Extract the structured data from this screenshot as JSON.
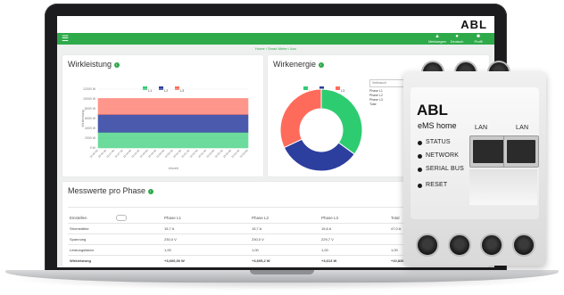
{
  "app": {
    "logo": "ABL",
    "breadcrumb": "Home / Smart Meter / Aux",
    "nav": [
      {
        "label": "Meldungen",
        "icon": "bell-icon"
      },
      {
        "label": "Deutsch",
        "icon": "language-icon"
      },
      {
        "label": "Profil",
        "icon": "user-icon"
      }
    ]
  },
  "wirkleistung": {
    "title": "Wirkleistung",
    "legend": [
      "L1",
      "L2",
      "L3"
    ],
    "y_ticks": [
      "12000 W",
      "10000 W",
      "8000 W",
      "6000 W",
      "4000 W",
      "2000 W",
      "0 W"
    ],
    "ylabel": "Wirkleistung",
    "xlabel": "Uhrzeit",
    "x_ticks": [
      "10:46:00",
      "10:46:30",
      "10:47:00",
      "10:47:30",
      "10:48:00",
      "10:48:30",
      "10:49:00",
      "10:49:30",
      "10:50:00",
      "10:50:30",
      "10:51:00",
      "10:51:30",
      "10:52:00",
      "10:52:30",
      "10:53:00",
      "10:53:30",
      "10:54:00",
      "10:54:30",
      "10:55:00"
    ]
  },
  "wirkenergie": {
    "title": "Wirkenergie",
    "legend": [
      "L1",
      "L2",
      "L3"
    ],
    "select_label": "Verbrauch",
    "list": [
      "Phase L1",
      "Phase L2",
      "Phase L3",
      "Total"
    ]
  },
  "colors": {
    "green": "#2eaa4a",
    "l1": "#2ecc71",
    "l2": "#2c3e9e",
    "l3": "#ff6b5b"
  },
  "chart_data": [
    {
      "type": "area",
      "title": "Wirkleistung",
      "xlabel": "Uhrzeit",
      "ylabel": "Wirkleistung",
      "ylim": [
        0,
        12000
      ],
      "series": [
        {
          "name": "L1",
          "values": [
            3200,
            3200,
            3200,
            3200,
            3200,
            3200,
            3200,
            3200,
            3200,
            3200,
            3200,
            3200,
            3200,
            3200,
            3200,
            3200,
            3200,
            3200,
            3200
          ]
        },
        {
          "name": "L2",
          "values": [
            3600,
            3600,
            3600,
            3600,
            3600,
            3600,
            3600,
            3600,
            3600,
            3600,
            3600,
            3600,
            3600,
            3600,
            3600,
            3600,
            3600,
            3600,
            3600
          ]
        },
        {
          "name": "L3",
          "values": [
            3300,
            3300,
            3300,
            3300,
            3300,
            3300,
            3300,
            3300,
            3300,
            3300,
            3300,
            3300,
            3300,
            3300,
            3300,
            3300,
            3300,
            3300,
            3300
          ]
        }
      ]
    },
    {
      "type": "pie",
      "title": "Wirkenergie",
      "categories": [
        "L1",
        "L2",
        "L3"
      ],
      "values": [
        35,
        33,
        32
      ]
    }
  ],
  "messwerte": {
    "title": "Messwerte pro Phase",
    "columns": [
      "Einstellen",
      "Phase L1",
      "Phase L2",
      "Phase L3",
      "Total"
    ],
    "rows": [
      {
        "label": "Stromstärke",
        "values": [
          "15,7 A",
          "15,7 A",
          "15,6 A",
          "47,0 A"
        ]
      },
      {
        "label": "Spannung",
        "values": [
          "230,0 V",
          "230,0 V",
          "229,7 V",
          ""
        ]
      },
      {
        "label": "Leistungsfaktor",
        "values": [
          "1,00",
          "1,00",
          "1,00",
          "1,00"
        ]
      },
      {
        "label": "Wirkleistung",
        "values": [
          "+3,600,00 W",
          "+3,605,2 W",
          "+3,613 W",
          "+10,836,8 W"
        ]
      }
    ]
  },
  "device": {
    "brand": "ABL",
    "model": "eMS home",
    "port_labels": [
      "LAN",
      "LAN"
    ],
    "leds": [
      "STATUS",
      "NETWORK",
      "SERIAL BUS"
    ],
    "reset": "RESET"
  }
}
